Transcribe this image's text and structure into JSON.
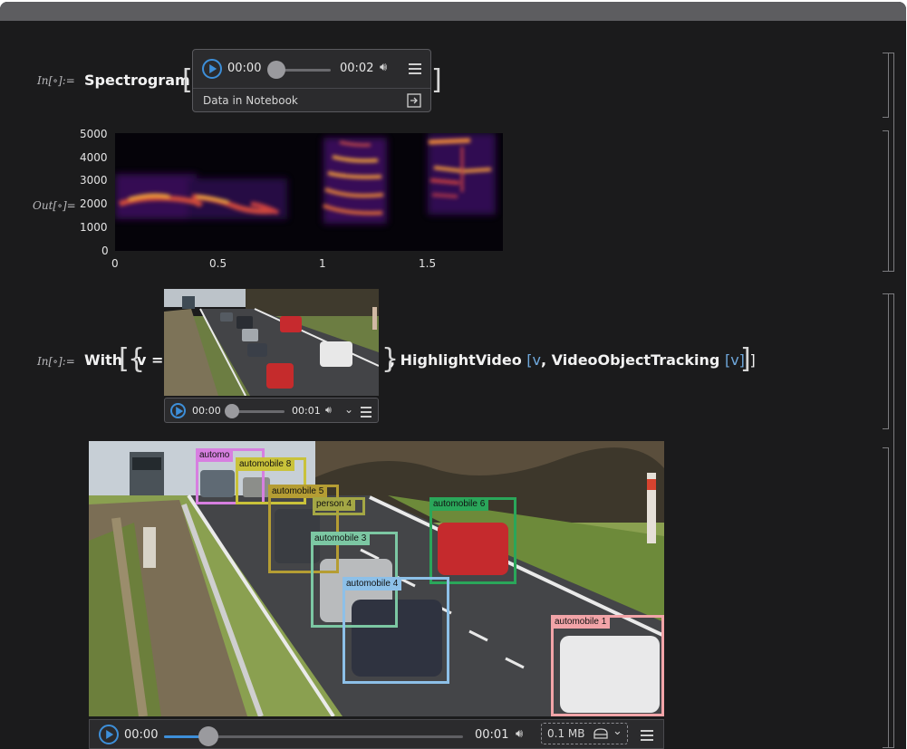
{
  "cell1": {
    "in_label": "In[∘]:=",
    "function": "Spectrogram",
    "audio": {
      "time_current": "00:00",
      "time_total": "00:02",
      "data_label": "Data in Notebook"
    }
  },
  "output1": {
    "out_label": "Out[∘]=",
    "y_ticks": [
      "5000",
      "4000",
      "3000",
      "2000",
      "1000",
      "0"
    ],
    "x_ticks": [
      "0",
      "0.5",
      "1",
      "1.5"
    ]
  },
  "cell2": {
    "in_label": "In[∘]:=",
    "with_kw": "With",
    "var_eq": "v =",
    "close_part": ", HighlightVideo",
    "var_v": "v",
    "comma_vot": ", VideoObjectTracking",
    "var_v2": "v",
    "close_all": "]",
    "video": {
      "time_current": "00:00",
      "time_total": "00:01"
    }
  },
  "output2": {
    "labels": {
      "automobile_top": "automo",
      "automobile8": "automobile 8",
      "automobile5": "automobile 5",
      "person4": "person 4",
      "automobile6": "automobile 6",
      "automobile3": "automobile 3",
      "automobile4": "automobile 4",
      "automobile1": "automobile 1"
    },
    "controls": {
      "time_current": "00:00",
      "time_total": "00:01",
      "size": "0.1 MB"
    }
  },
  "colors": {
    "accent": "#3d8fd9",
    "background": "#1b1b1c"
  }
}
